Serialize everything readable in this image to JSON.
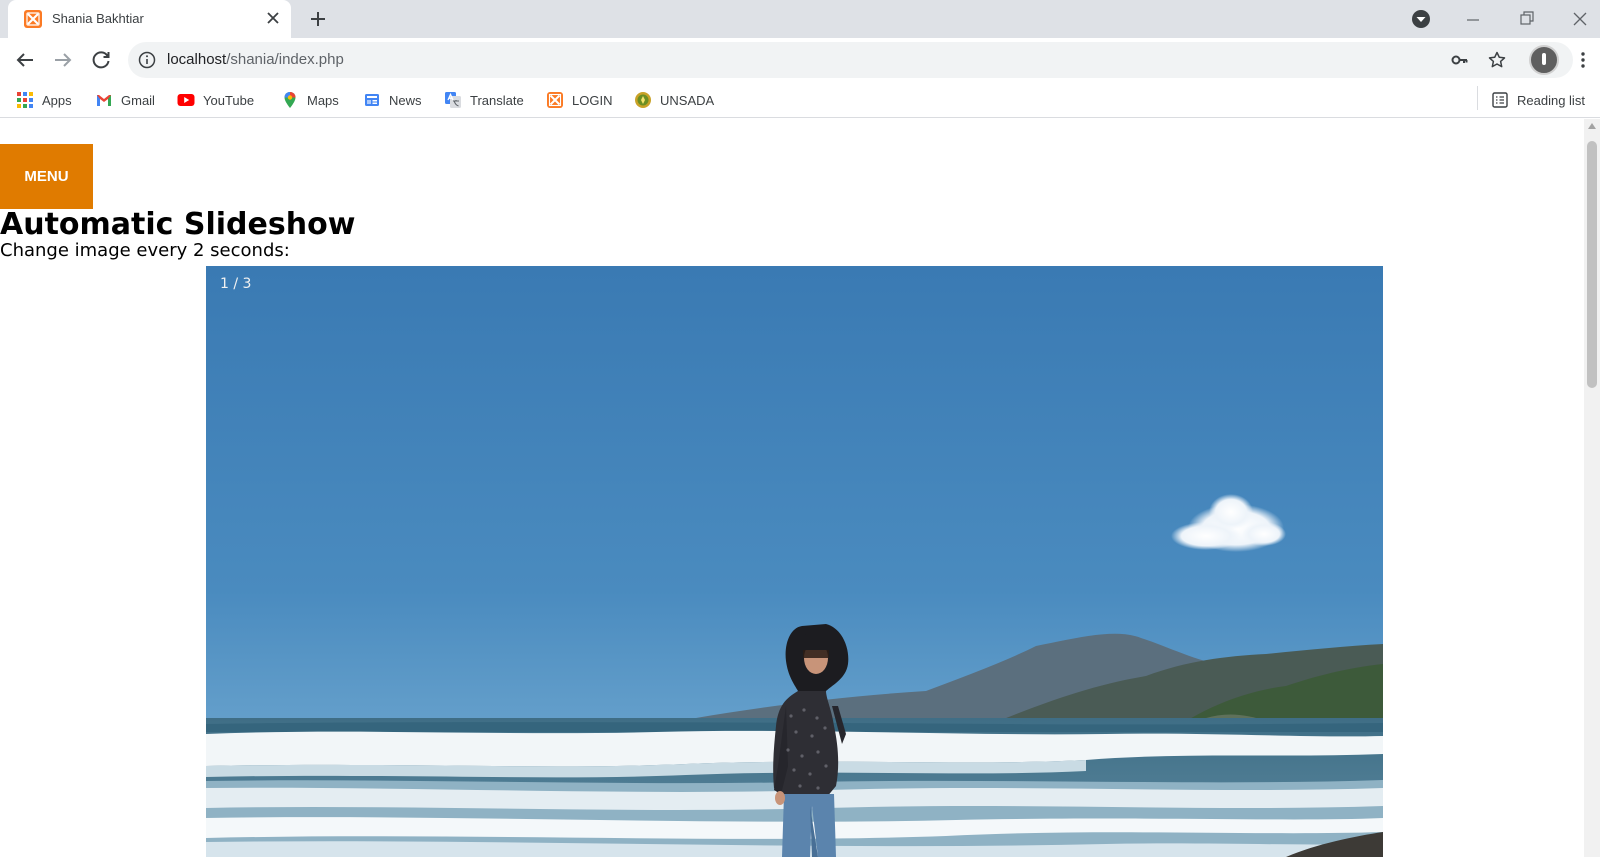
{
  "browser": {
    "tab": {
      "title": "Shania Bakhtiar",
      "favicon": "xampp-icon"
    },
    "address": {
      "host": "localhost",
      "path": "/shania/index.php"
    },
    "bookmarks": [
      {
        "label": "Apps",
        "icon": "apps-grid-icon"
      },
      {
        "label": "Gmail",
        "icon": "gmail-icon"
      },
      {
        "label": "YouTube",
        "icon": "youtube-icon"
      },
      {
        "label": "Maps",
        "icon": "maps-icon"
      },
      {
        "label": "News",
        "icon": "news-icon"
      },
      {
        "label": "Translate",
        "icon": "translate-icon"
      },
      {
        "label": "LOGIN",
        "icon": "xampp-icon"
      },
      {
        "label": "UNSADA",
        "icon": "unsada-logo-icon"
      }
    ],
    "reading_list": "Reading list"
  },
  "page": {
    "menu_button": "MENU",
    "title": "Automatic Slideshow",
    "subtitle": "Change image every 2 seconds:",
    "slideshow": {
      "number_text": "1 / 3"
    }
  },
  "colors": {
    "menu_button_bg": "#e07b00",
    "xampp_orange": "#fb7a24",
    "tab_strip": "#dee1e6"
  }
}
